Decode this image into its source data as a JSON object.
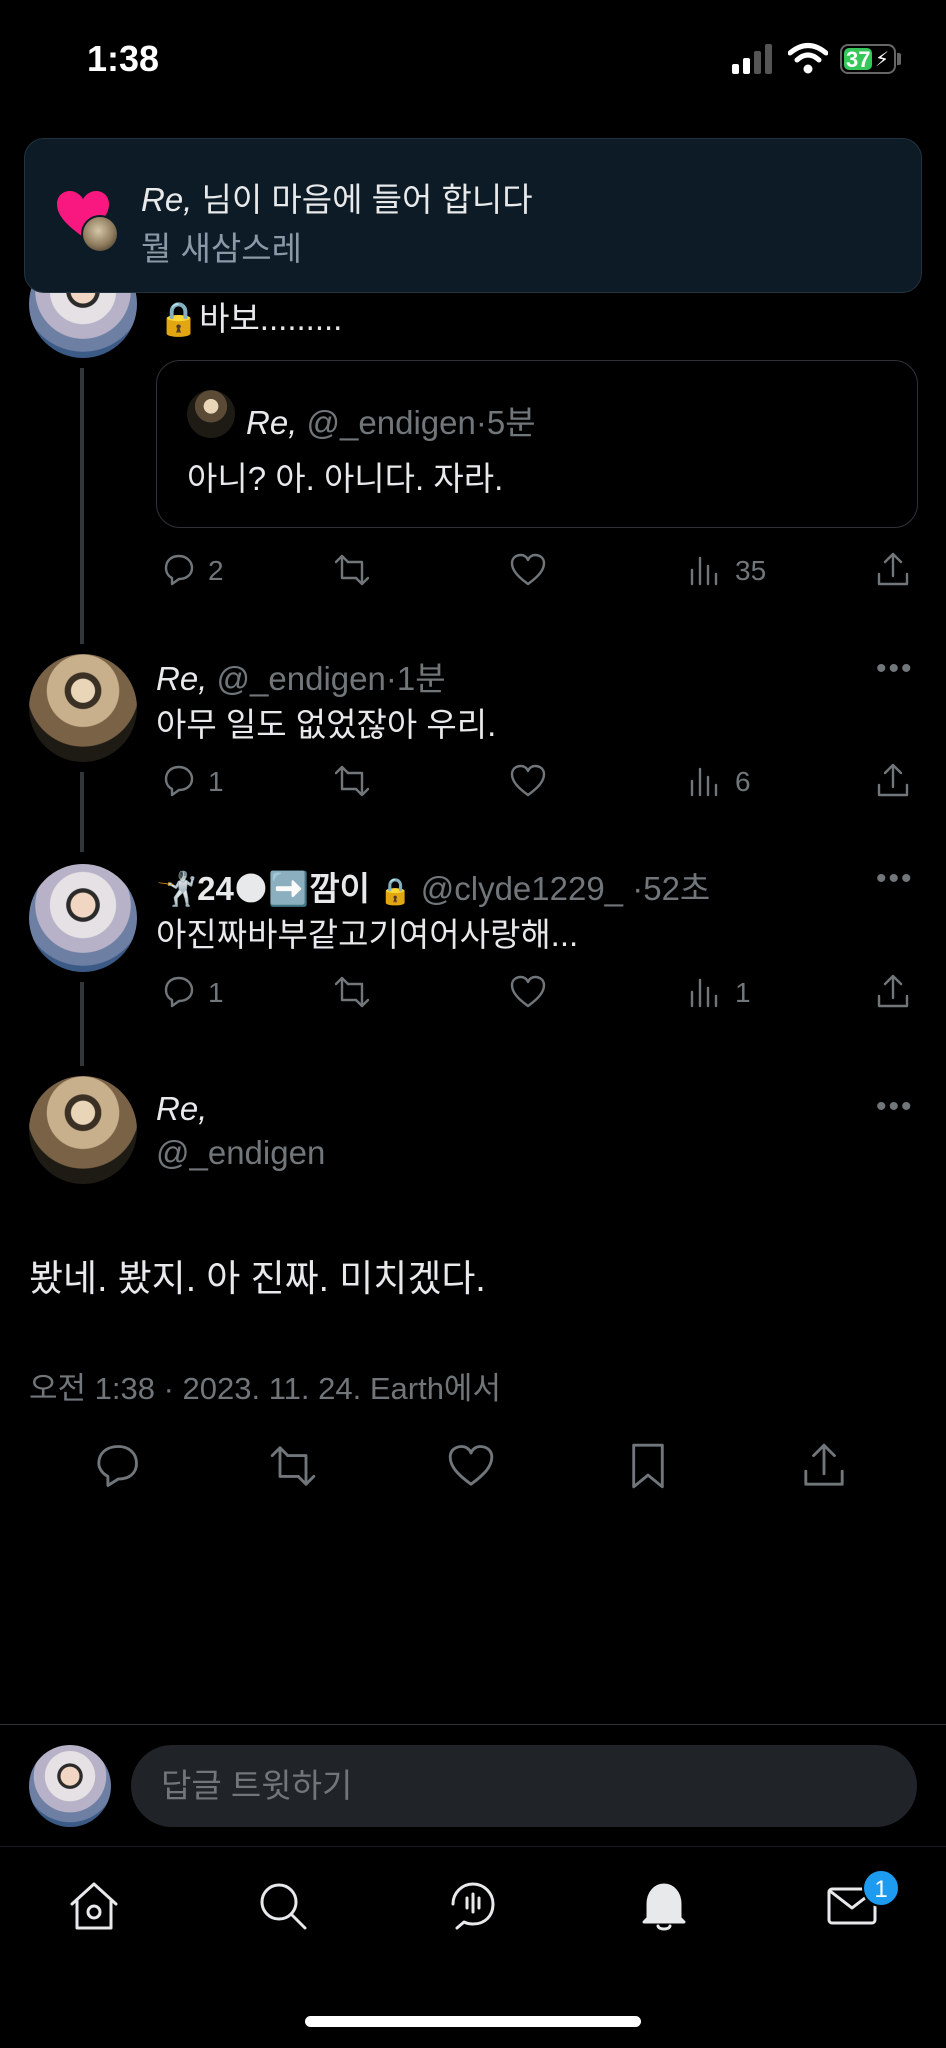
{
  "status_bar": {
    "time": "1:38",
    "battery": "37"
  },
  "banner": {
    "name": "Re,",
    "title_rest": " 님이 마음에 들어 합니다",
    "subtitle": "뭘 새삼스레"
  },
  "tweet1": {
    "text": "🔒바보.........",
    "quote": {
      "name": "Re,",
      "handle": "@_endigen",
      "dot": "·",
      "time": "5분",
      "text": "아니? 아. 아니다. 자라."
    },
    "reply_count": "2",
    "views": "35"
  },
  "tweet2": {
    "name": "Re,",
    "handle": "@_endigen",
    "dot": "·",
    "time": "1분",
    "text": "아무 일도 없었잖아 우리.",
    "reply_count": "1",
    "views": "6"
  },
  "tweet3": {
    "name": "🤺24🌑➡️깜이",
    "lock": "🔒",
    "handle": "@clyde1229_",
    "dot": "·",
    "time": "52초",
    "text": "아진짜바부같고기여어사랑해...",
    "reply_count": "1",
    "views": "1"
  },
  "main_tweet": {
    "name": "Re,",
    "handle": "@_endigen",
    "text": "봤네. 봤지. 아 진짜. 미치겠다.",
    "meta": "오전 1:38 · 2023. 11. 24. Earth에서"
  },
  "reply_bar": {
    "placeholder": "답글 트윗하기"
  },
  "tab_bar": {
    "dm_badge": "1"
  },
  "colors": {
    "background": "#000000",
    "muted": "#71767b",
    "accent": "#1d9bf0",
    "heart": "#f91880"
  }
}
